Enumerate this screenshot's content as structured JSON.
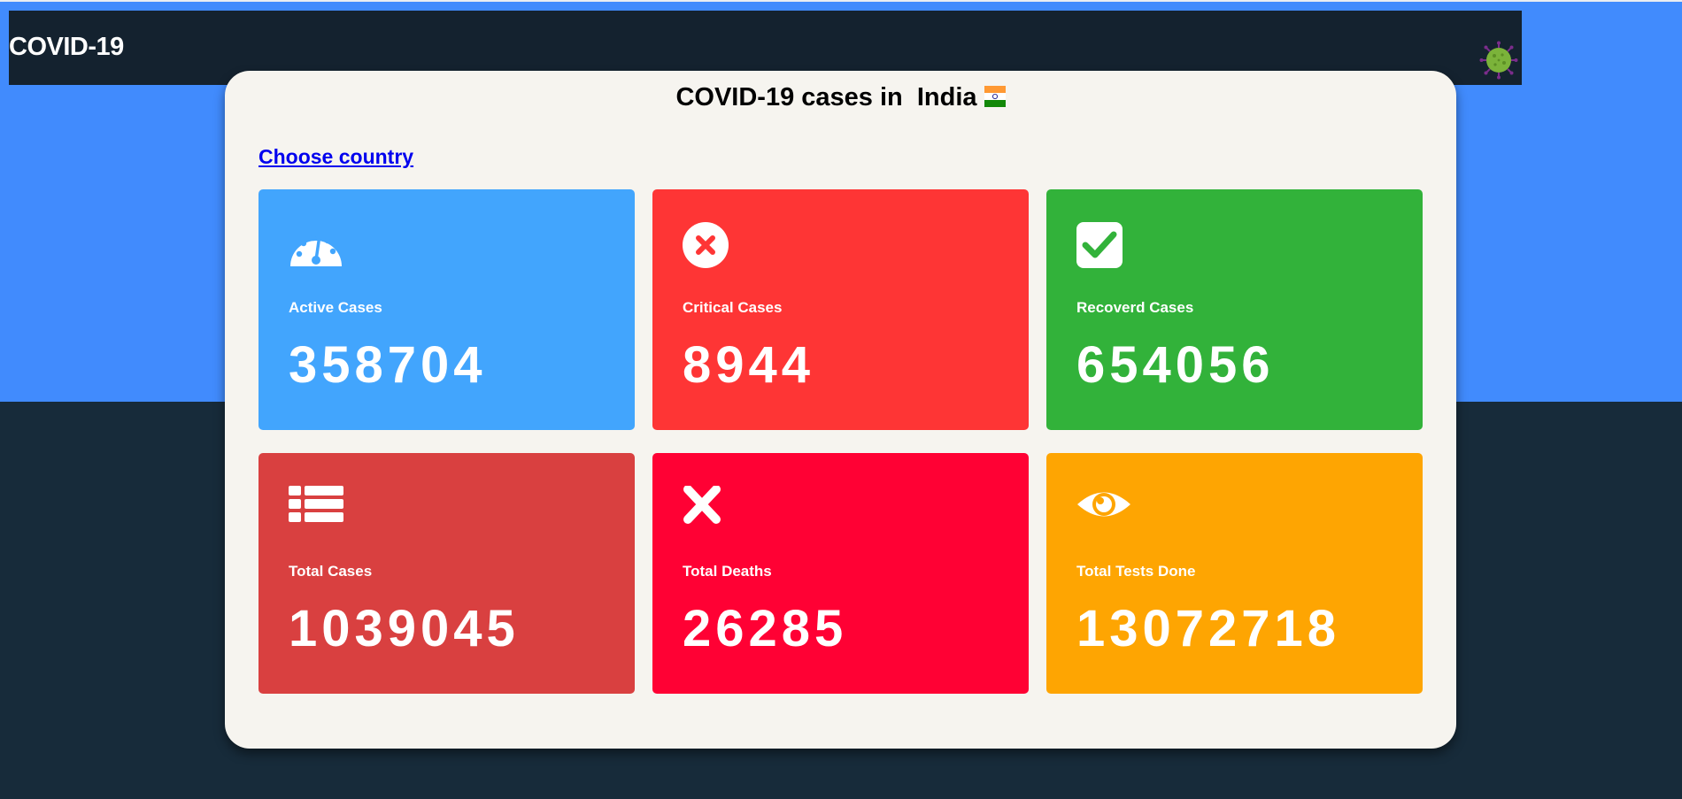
{
  "navbar": {
    "brand": "COVID-19",
    "icon": "virus-icon"
  },
  "main": {
    "title_prefix": "COVID-19 cases in",
    "country": "India",
    "flag_icon": "india-flag-icon",
    "choose_country_link": "Choose country"
  },
  "stats": [
    {
      "label": "Active Cases",
      "value": "358704",
      "color": "#42a5fd",
      "icon": "dashboard-gauge-icon"
    },
    {
      "label": "Critical Cases",
      "value": "8944",
      "color": "#fe3535",
      "icon": "times-circle-icon"
    },
    {
      "label": "Recoverd Cases",
      "value": "654056",
      "color": "#32b23a",
      "icon": "check-square-icon"
    },
    {
      "label": "Total Cases",
      "value": "1039045",
      "color": "#d94040",
      "icon": "list-icon"
    },
    {
      "label": "Total Deaths",
      "value": "26285",
      "color": "#ff0134",
      "icon": "times-icon"
    },
    {
      "label": "Total Tests Done",
      "value": "13072718",
      "color": "#fea502",
      "icon": "eye-icon"
    }
  ],
  "colors": {
    "header_blue": "#418bfd",
    "navbar_dark": "#14222f",
    "page_dark": "#172b3a",
    "card_bg": "#f6f4ef"
  }
}
